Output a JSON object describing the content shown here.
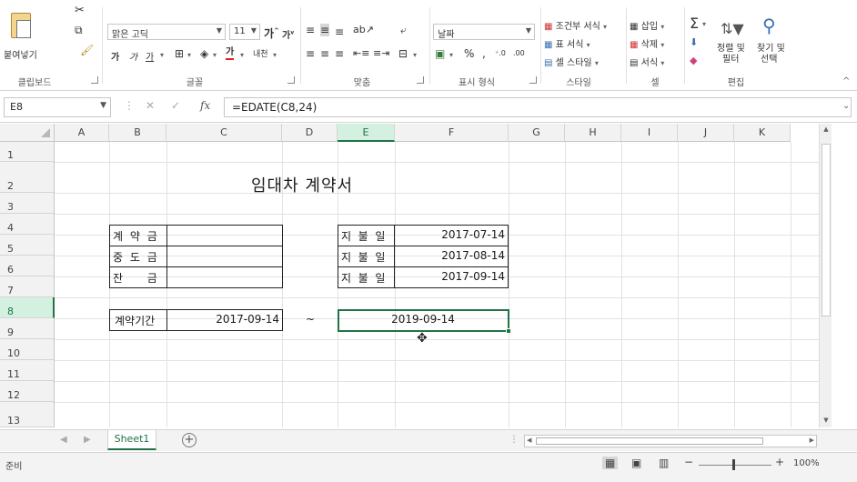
{
  "ribbon": {
    "clipboard": {
      "paste_label": "붙여넣기",
      "group_label": "클립보드"
    },
    "font": {
      "font_name": "맑은 고딕",
      "font_size": "11",
      "group_label": "글꼴",
      "bold": "가",
      "italic": "가",
      "underline": "가"
    },
    "alignment": {
      "group_label": "맞춤"
    },
    "number": {
      "format": "날짜",
      "percent": "%",
      "comma": ",",
      "group_label": "표시 형식"
    },
    "styles": {
      "conditional": "조건부 서식",
      "table": "표 서식",
      "cell_styles": "셀 스타일",
      "group_label": "스타일"
    },
    "cells": {
      "insert": "삽입",
      "delete": "삭제",
      "format": "서식",
      "group_label": "셀"
    },
    "editing": {
      "sort": "정렬 및",
      "sort2": "필터",
      "find": "찾기 및",
      "find2": "선택",
      "group_label": "편집"
    }
  },
  "formula_bar": {
    "name_box": "E8",
    "fx": "fx",
    "formula": "=EDATE(C8,24)"
  },
  "columns": [
    "A",
    "B",
    "C",
    "D",
    "E",
    "F",
    "G",
    "H",
    "I",
    "J",
    "K"
  ],
  "rows": [
    "1",
    "2",
    "3",
    "4",
    "5",
    "6",
    "7",
    "8",
    "9",
    "10",
    "11",
    "12",
    "13"
  ],
  "sheet": {
    "title": "임대차 계약서",
    "left_labels": [
      "계 약 금",
      "중 도 금",
      "잔       금"
    ],
    "right_labels": [
      "지  불  일",
      "지  불  일",
      "지  불  일"
    ],
    "right_dates": [
      "2017-07-14",
      "2017-08-14",
      "2017-09-14"
    ],
    "period_label": "계약기간",
    "period_start": "2017-09-14",
    "period_sep": "~",
    "period_end": "2019-09-14"
  },
  "tabs": {
    "sheet1": "Sheet1",
    "add": "+"
  },
  "status": {
    "ready": "준비",
    "zoom": "100%"
  },
  "colors": {
    "accent": "#217346"
  }
}
